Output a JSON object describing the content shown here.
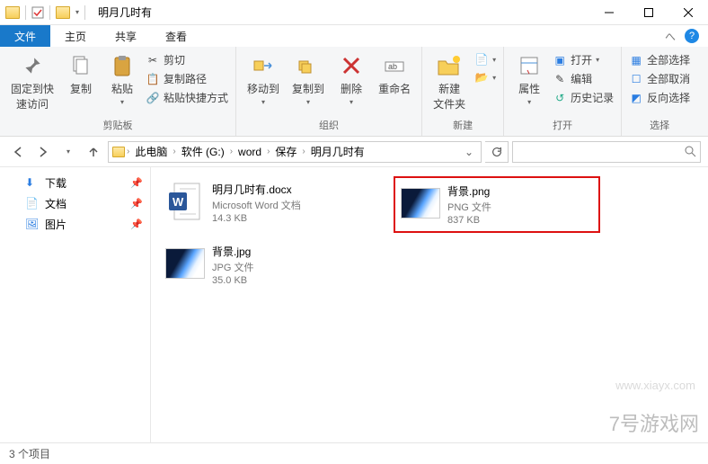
{
  "window": {
    "title": "明月几时有",
    "btn_min": "–",
    "btn_max": "□",
    "btn_close": "✕"
  },
  "tabs": {
    "file": "文件",
    "home": "主页",
    "share": "共享",
    "view": "查看"
  },
  "ribbon": {
    "pin_quick": "固定到快\n速访问",
    "copy": "复制",
    "paste": "粘贴",
    "cut": "剪切",
    "copy_path": "复制路径",
    "paste_shortcut": "粘贴快捷方式",
    "group_clipboard": "剪贴板",
    "move_to": "移动到",
    "copy_to": "复制到",
    "delete": "删除",
    "rename": "重命名",
    "group_organize": "组织",
    "new_folder": "新建\n文件夹",
    "group_new": "新建",
    "properties": "属性",
    "open": "打开",
    "edit": "编辑",
    "history": "历史记录",
    "group_open": "打开",
    "select_all": "全部选择",
    "select_none": "全部取消",
    "invert": "反向选择",
    "group_select": "选择"
  },
  "nav": {
    "this_pc": "此电脑",
    "drive": "软件 (G:)",
    "folder1": "word",
    "folder2": "保存",
    "folder3": "明月几时有",
    "search_placeholder": ""
  },
  "sidebar": {
    "downloads": "下载",
    "documents": "文档",
    "pictures": "图片"
  },
  "files": {
    "f1": {
      "name": "明月几时有.docx",
      "type": "Microsoft Word 文档",
      "size": "14.3 KB"
    },
    "f2": {
      "name": "背景.png",
      "type": "PNG 文件",
      "size": "837 KB"
    },
    "f3": {
      "name": "背景.jpg",
      "type": "JPG 文件",
      "size": "35.0 KB"
    }
  },
  "status": {
    "count": "3 个项目"
  },
  "watermark": {
    "text": "7号游戏网",
    "url": "www.xiayx.com"
  }
}
